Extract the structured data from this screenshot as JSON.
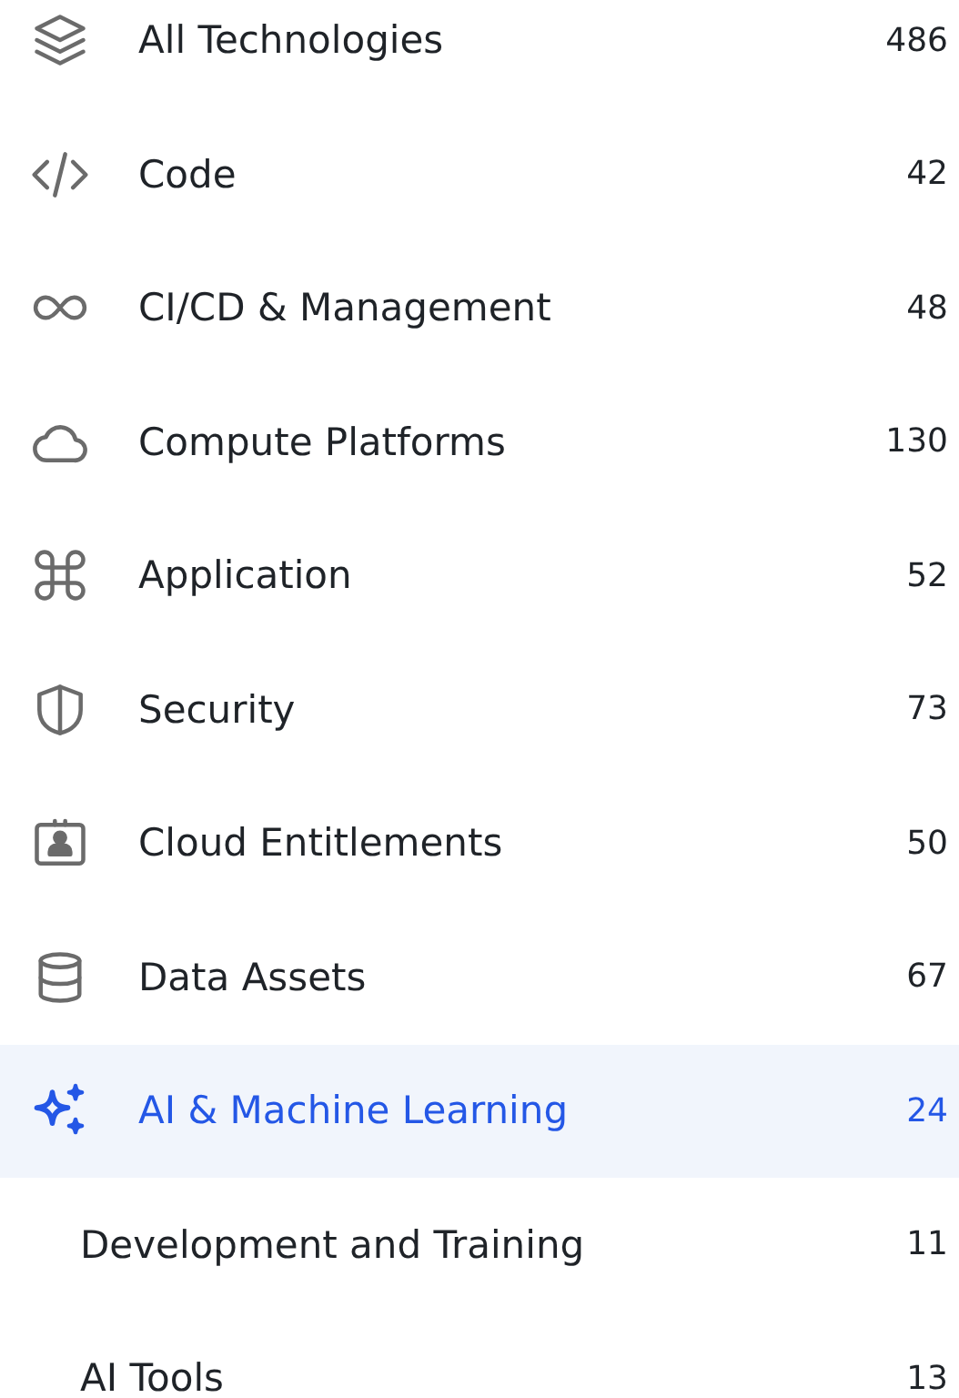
{
  "categories": [
    {
      "label": "All Technologies",
      "count": "486",
      "selected": false
    },
    {
      "label": "Code",
      "count": "42",
      "selected": false
    },
    {
      "label": "CI/CD & Management",
      "count": "48",
      "selected": false
    },
    {
      "label": "Compute Platforms",
      "count": "130",
      "selected": false
    },
    {
      "label": "Application",
      "count": "52",
      "selected": false
    },
    {
      "label": "Security",
      "count": "73",
      "selected": false
    },
    {
      "label": "Cloud Entitlements",
      "count": "50",
      "selected": false
    },
    {
      "label": "Data Assets",
      "count": "67",
      "selected": false
    },
    {
      "label": "AI & Machine Learning",
      "count": "24",
      "selected": true,
      "children": [
        {
          "label": "Development and Training",
          "count": "11",
          "selected": false
        },
        {
          "label": "AI Tools",
          "count": "13",
          "selected": false
        }
      ]
    }
  ]
}
